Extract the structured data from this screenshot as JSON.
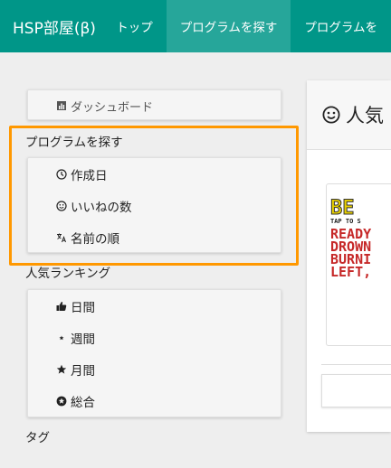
{
  "navbar": {
    "brand": "HSP部屋(β)",
    "items": [
      {
        "label": "トップ",
        "active": false
      },
      {
        "label": "プログラムを探す",
        "active": true
      },
      {
        "label": "プログラムを",
        "active": false
      }
    ],
    "bg_color": "#009688",
    "active_color": "#26a69a"
  },
  "sidebar": {
    "dashboard": {
      "icon": "bar-chart-icon",
      "label": "ダッシュボード"
    },
    "sections": [
      {
        "title": "プログラムを探す",
        "items": [
          {
            "icon": "clock-icon",
            "label": "作成日"
          },
          {
            "icon": "smile-icon",
            "label": "いいねの数"
          },
          {
            "icon": "translate-icon",
            "label": "名前の順"
          }
        ]
      },
      {
        "title": "人気ランキング",
        "items": [
          {
            "icon": "thumbs-up-icon",
            "label": "日間"
          },
          {
            "icon": "small-star-icon",
            "label": "週間"
          },
          {
            "icon": "star-icon",
            "label": "月間"
          },
          {
            "icon": "star-circle-icon",
            "label": "総合"
          }
        ]
      },
      {
        "title": "タグ",
        "items": []
      }
    ],
    "highlight_color": "#ff9800"
  },
  "main": {
    "header": {
      "icon": "smile-icon",
      "title": "人気"
    },
    "thumbnail": {
      "lines": [
        "BE",
        "TAP TO S",
        "READY",
        "DROWN",
        "BURNI",
        "LEFT,"
      ]
    }
  }
}
